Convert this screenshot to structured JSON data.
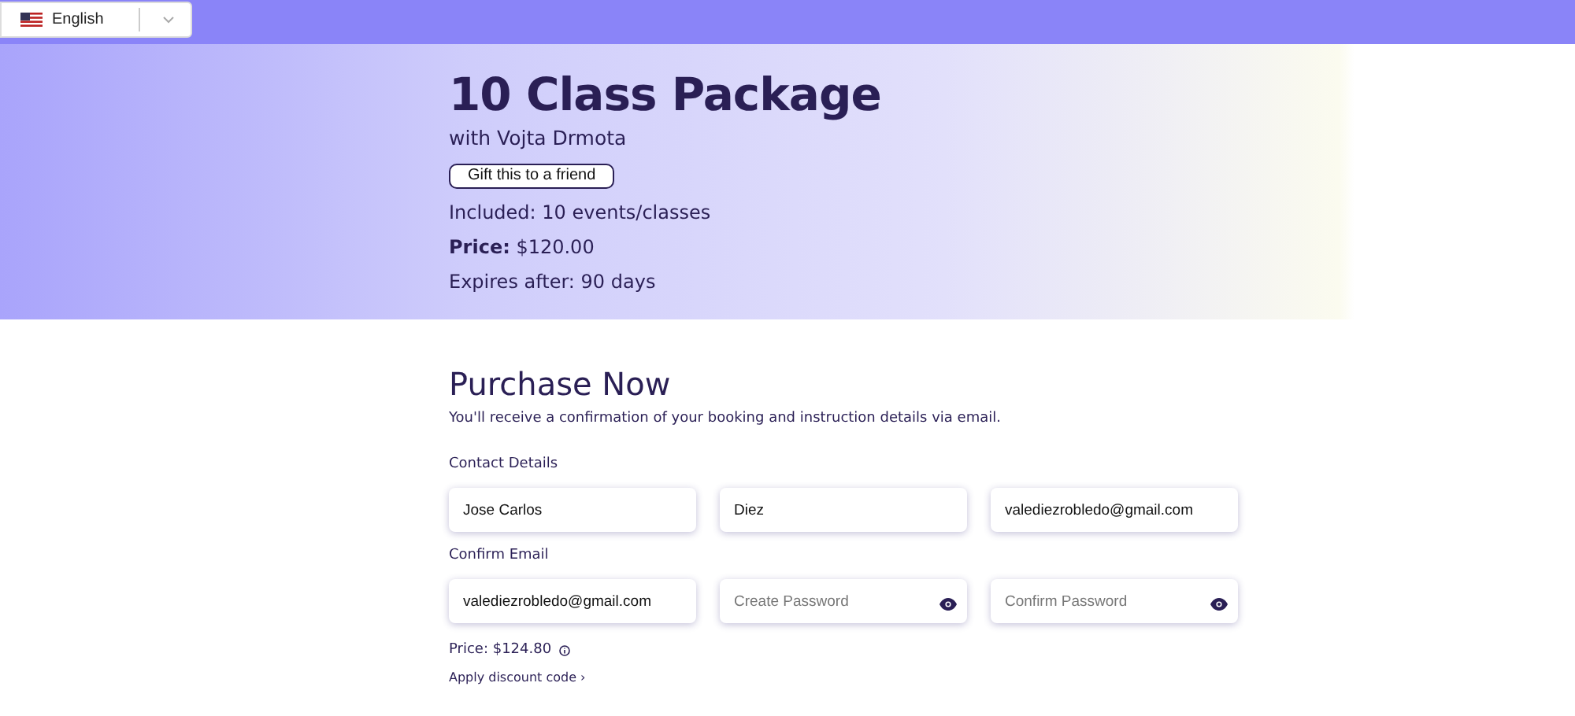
{
  "language_select": {
    "value": "English"
  },
  "package": {
    "title": "10 Class Package",
    "instructor": "with Vojta Drmota",
    "gift_button": "Gift this to a friend",
    "details": [
      "Included: 10 events/classes",
      "**Price:** $120.00",
      "Expires after: 90 days"
    ]
  },
  "purchase": {
    "title": "Purchase Now",
    "intro": "You'll receive a confirmation of your booking and instruction details via email.",
    "sections": [
      {
        "label": "Contact Details",
        "fields": [
          {
            "kind": "text",
            "value": "Jose Carlos"
          },
          {
            "kind": "text",
            "value": "Diez"
          },
          {
            "kind": "text",
            "value": "valediezrobledo@gmail.com"
          }
        ]
      },
      {
        "label": "Confirm Email",
        "fields": [
          {
            "kind": "text",
            "value": "valediezrobledo@gmail.com"
          },
          {
            "kind": "password",
            "placeholder": "Create Password"
          },
          {
            "kind": "password",
            "placeholder": "Confirm Password"
          }
        ]
      }
    ],
    "price": "Price: $124.80",
    "discount_link": "Apply discount code ›"
  }
}
